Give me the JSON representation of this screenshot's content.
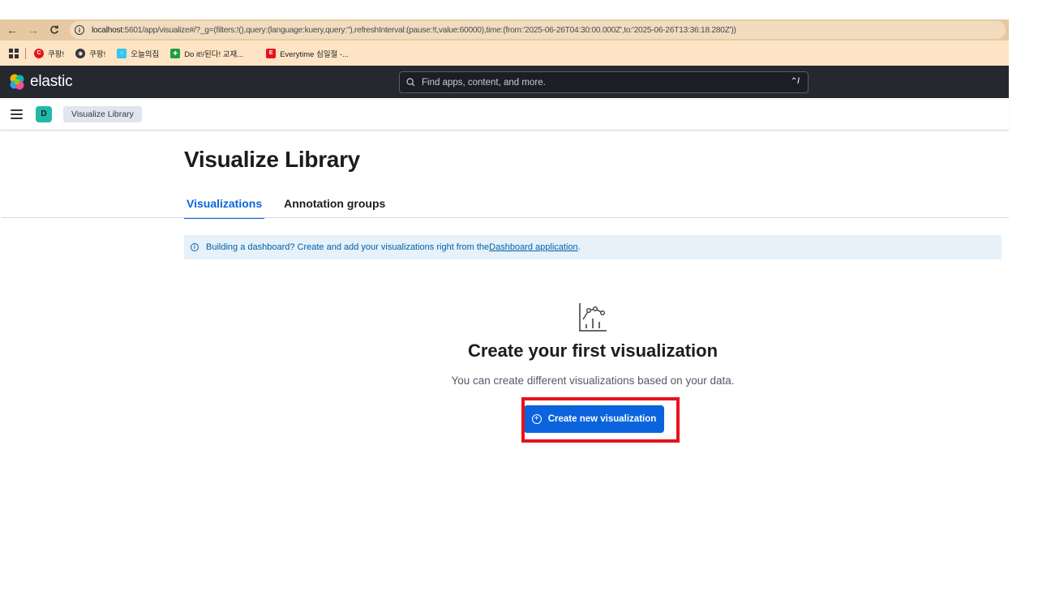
{
  "browser": {
    "back_glyph": "←",
    "forward_glyph": "→",
    "reload_glyph": "C",
    "url_host": "localhost",
    "url_rest": ":5601/app/visualize#/?_g=(filters:!(),query:(language:kuery,query:''),refreshInterval:(pause:!t,value:60000),time:(from:'2025-06-26T04:30:00.000Z',to:'2025-06-26T13:36:18.280Z'))"
  },
  "bookmarks": [
    {
      "label": "쿠팡!",
      "icon": "coupang-icon",
      "color": "#e8121b",
      "glyph": "C"
    },
    {
      "label": "쿠팡!",
      "icon": "globe-icon",
      "color": "#333333",
      "glyph": "◉"
    },
    {
      "label": "오늘의집",
      "icon": "house-icon",
      "color": "#35c5f0",
      "glyph": "⌂"
    },
    {
      "label": "Do it!/된다! 교재...",
      "icon": "book-icon",
      "color": "#1e9e3e",
      "glyph": "✚"
    },
    {
      "label": "Everytime 심일절 -...",
      "icon": "everytime-icon",
      "color": "#e8121b",
      "glyph": "E"
    }
  ],
  "header": {
    "logo_text": "elastic",
    "search_placeholder": "Find apps, content, and more.",
    "search_shortcut": "⌃/"
  },
  "subheader": {
    "space_initial": "D",
    "breadcrumb": "Visualize Library"
  },
  "page": {
    "title": "Visualize Library",
    "tabs": [
      {
        "label": "Visualizations",
        "active": true
      },
      {
        "label": "Annotation groups",
        "active": false
      }
    ],
    "callout": {
      "text": "Building a dashboard? Create and add your visualizations right from the ",
      "link": "Dashboard application",
      "suffix": "."
    },
    "empty_state": {
      "icon": "visualize-app-icon",
      "title": "Create your first visualization",
      "body": "You can create different visualizations based on your data.",
      "button": "Create new visualization"
    }
  },
  "colors": {
    "primary": "#0b64dd",
    "header_bg": "#25282f",
    "highlight": "#e8121b"
  }
}
